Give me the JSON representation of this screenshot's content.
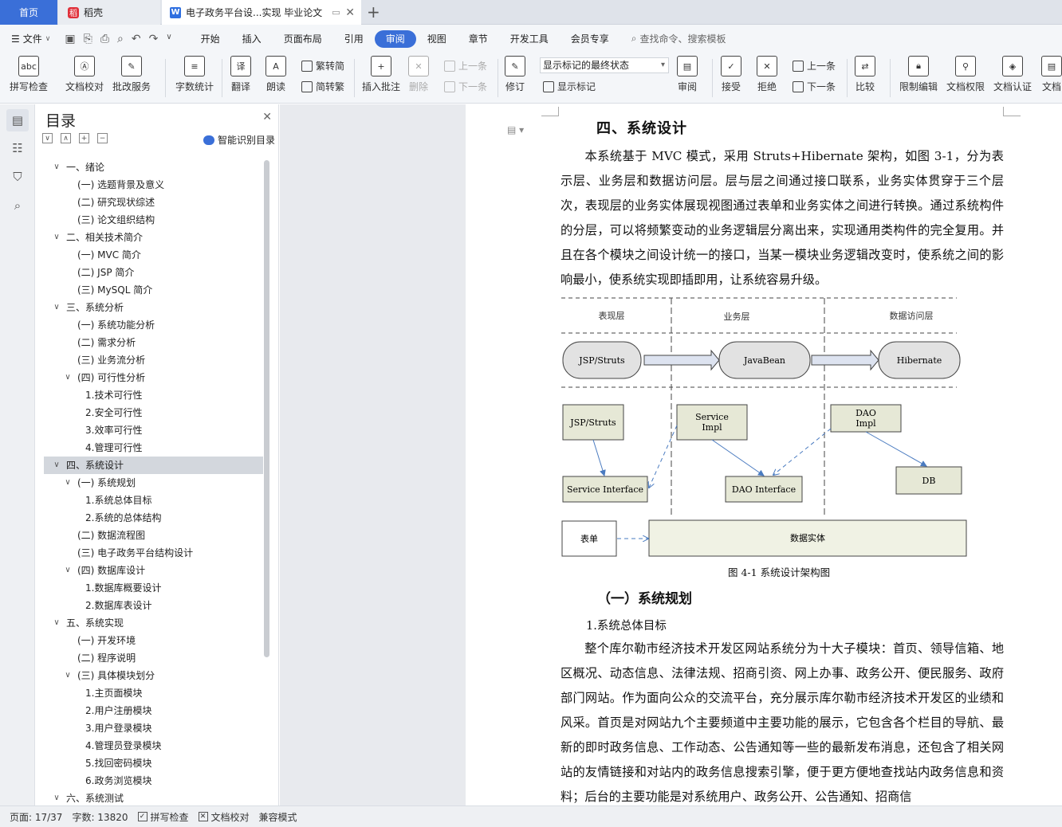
{
  "tabs": {
    "home": "首页",
    "daoke": "稻壳",
    "doc": "电子政务平台设...实现 毕业论文"
  },
  "menubar": {
    "file": "文件",
    "items": [
      "开始",
      "插入",
      "页面布局",
      "引用",
      "审阅",
      "视图",
      "章节",
      "开发工具",
      "会员专享"
    ],
    "active": "审阅",
    "search": "查找命令、搜索模板"
  },
  "ribbon": {
    "spellcheck": "拼写检查",
    "doccheck": "文档校对",
    "annotate_service": "批改服务",
    "wordcount": "字数统计",
    "translate": "翻译",
    "read": "朗读",
    "trad": "繁转简",
    "simp": "简转繁",
    "insert_comment": "插入批注",
    "delete": "删除",
    "prev": "上一条",
    "next": "下一条",
    "revise": "修订",
    "markup_select": "显示标记的最终状态",
    "show_markup": "显示标记",
    "review": "审阅",
    "accept": "接受",
    "reject": "拒绝",
    "prev2": "上一条",
    "next2": "下一条",
    "compare": "比较",
    "restrict": "限制编辑",
    "perm": "文档权限",
    "cert": "文档认证",
    "docx": "文档"
  },
  "toc": {
    "title": "目录",
    "smart": "智能识别目录",
    "items": [
      {
        "t": "一、绪论",
        "lvl": 0,
        "tw": "v"
      },
      {
        "t": "(一) 选题背景及意义",
        "lvl": 1
      },
      {
        "t": "(二) 研究现状综述",
        "lvl": 1
      },
      {
        "t": "(三) 论文组织结构",
        "lvl": 1
      },
      {
        "t": "二、相关技术简介",
        "lvl": 0,
        "tw": "v"
      },
      {
        "t": "(一) MVC 简介",
        "lvl": 1
      },
      {
        "t": "(二) JSP 简介",
        "lvl": 1
      },
      {
        "t": "(三) MySQL 简介",
        "lvl": 1
      },
      {
        "t": "三、系统分析",
        "lvl": 0,
        "tw": "v"
      },
      {
        "t": "(一) 系统功能分析",
        "lvl": 1
      },
      {
        "t": "(二) 需求分析",
        "lvl": 1
      },
      {
        "t": "(三) 业务流分析",
        "lvl": 1
      },
      {
        "t": "(四) 可行性分析",
        "lvl": 1,
        "tw": "v"
      },
      {
        "t": "1.技术可行性",
        "lvl": 2
      },
      {
        "t": "2.安全可行性",
        "lvl": 2
      },
      {
        "t": "3.效率可行性",
        "lvl": 2
      },
      {
        "t": "4.管理可行性",
        "lvl": 2
      },
      {
        "t": "四、系统设计",
        "lvl": 0,
        "tw": "v",
        "sel": true
      },
      {
        "t": "(一) 系统规划",
        "lvl": 1,
        "tw": "v"
      },
      {
        "t": "1.系统总体目标",
        "lvl": 2
      },
      {
        "t": "2.系统的总体结构",
        "lvl": 2
      },
      {
        "t": "(二) 数据流程图",
        "lvl": 1
      },
      {
        "t": "(三) 电子政务平台结构设计",
        "lvl": 1
      },
      {
        "t": "(四) 数据库设计",
        "lvl": 1,
        "tw": "v"
      },
      {
        "t": "1.数据库概要设计",
        "lvl": 2
      },
      {
        "t": "2.数据库表设计",
        "lvl": 2
      },
      {
        "t": "五、系统实现",
        "lvl": 0,
        "tw": "v"
      },
      {
        "t": "(一) 开发环境",
        "lvl": 1
      },
      {
        "t": "(二) 程序说明",
        "lvl": 1
      },
      {
        "t": "(三) 具体模块划分",
        "lvl": 1,
        "tw": "v"
      },
      {
        "t": "1.主页面模块",
        "lvl": 2
      },
      {
        "t": "2.用户注册模块",
        "lvl": 2
      },
      {
        "t": "3.用户登录模块",
        "lvl": 2
      },
      {
        "t": "4.管理员登录模块",
        "lvl": 2
      },
      {
        "t": "5.找回密码模块",
        "lvl": 2
      },
      {
        "t": "6.政务浏览模块",
        "lvl": 2
      },
      {
        "t": "六、系统测试",
        "lvl": 0,
        "tw": "v"
      }
    ]
  },
  "doc": {
    "heading1": "四、系统设计",
    "para1": "本系统基于 MVC 模式，采用 Struts+Hibernate 架构，如图 3-1，分为表示层、业务层和数据访问层。层与层之间通过接口联系，业务实体贯穿于三个层次，表现层的业务实体展现视图通过表单和业务实体之间进行转换。通过系统构件的分层，可以将频繁变动的业务逻辑层分离出来，实现通用类构件的完全复用。并且在各个模块之间设计统一的接口，当某一模块业务逻辑改变时，使系统之间的影响最小，使系统实现即插即用，让系统容易升级。",
    "figure": {
      "layer1": "表现层",
      "layer2": "业务层",
      "layer3": "数据访问层",
      "jsp": "JSP/Struts",
      "javabean": "JavaBean",
      "hibernate": "Hibernate",
      "jsp2": "JSP/Struts",
      "service_impl": "Service Impl",
      "dao_impl": "DAO Impl",
      "service_if": "Service Interface",
      "dao_if": "DAO Interface",
      "db": "DB",
      "form": "表单",
      "entity": "数据实体"
    },
    "caption": "图 4-1 系统设计架构图",
    "heading2": "（一）系统规划",
    "heading3": "1.系统总体目标",
    "para2": "整个库尔勒市经济技术开发区网站系统分为十大子模块：首页、领导信箱、地区概况、动态信息、法律法规、招商引资、网上办事、政务公开、便民服务、政府部门网站。作为面向公众的交流平台，充分展示库尔勒市经济技术开发区的业绩和风采。首页是对网站九个主要频道中主要功能的展示，它包含各个栏目的导航、最新的即时政务信息、工作动态、公告通知等一些的最新发布消息，还包含了相关网站的友情链接和对站内的政务信息搜索引擎，便于更方便地查找站内政务信息和资料；后台的主要功能是对系统用户、政务公开、公告通知、招商信"
  },
  "status": {
    "page": "页面: 17/37",
    "words": "字数: 13820",
    "spell": "拼写检查",
    "proof": "文档校对",
    "compat": "兼容模式"
  }
}
